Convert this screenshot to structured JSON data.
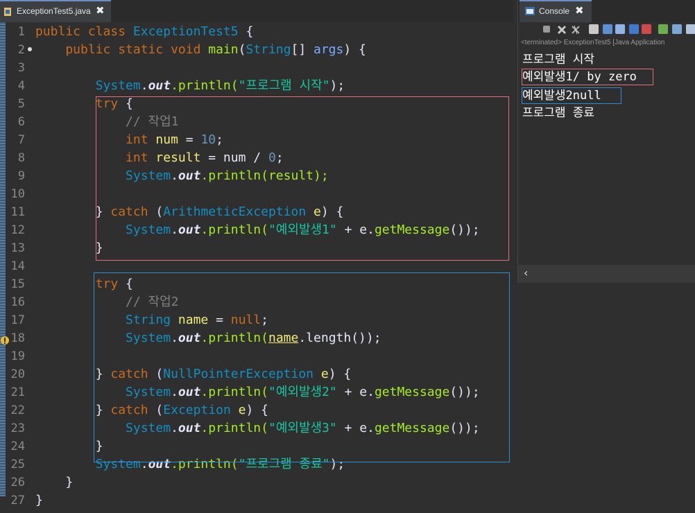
{
  "editor": {
    "tab_title": "ExceptionTest5.java",
    "close_glyph": "✖",
    "line_numbers": [
      "1",
      "2",
      "3",
      "4",
      "5",
      "6",
      "7",
      "8",
      "9",
      "10",
      "11",
      "12",
      "13",
      "14",
      "15",
      "16",
      "17",
      "18",
      "19",
      "20",
      "21",
      "22",
      "23",
      "24",
      "25",
      "26",
      "27"
    ],
    "code": {
      "l1": {
        "a": "public",
        "b": " class ",
        "c": "ExceptionTest5",
        "d": " {"
      },
      "l2": {
        "a": "    public",
        "b": " static",
        "c": " void",
        "d": " main",
        "e": "(",
        "f": "String",
        "g": "[] ",
        "h": "args",
        "i": ") {"
      },
      "l4": {
        "a": "        System",
        "b": ".",
        "c": "out",
        "d": ".println(",
        "e": "\"프로그램 시작\"",
        "f": ");"
      },
      "l5": {
        "a": "        try",
        "b": " {"
      },
      "l6": {
        "a": "            // 작업1"
      },
      "l7": {
        "a": "            int",
        "b": " num",
        "c": " = ",
        "d": "10",
        "e": ";"
      },
      "l8": {
        "a": "            int",
        "b": " result",
        "c": " = num / ",
        "d": "0",
        "e": ";"
      },
      "l9": {
        "a": "            System",
        "b": ".",
        "c": "out",
        "d": ".println(result);"
      },
      "l11": {
        "a": "        }",
        "b": " catch",
        "c": " (",
        "d": "ArithmeticException",
        "e": " e",
        "f": ") {"
      },
      "l12": {
        "a": "            System",
        "b": ".",
        "c": "out",
        "d": ".println(",
        "e": "\"예외발생1\"",
        "f": " + e.",
        "g": "getMessage",
        "h": "());"
      },
      "l13": {
        "a": "        }"
      },
      "l15": {
        "a": "        try",
        "b": " {"
      },
      "l16": {
        "a": "            // 작업2"
      },
      "l17": {
        "a": "            String",
        "b": " name",
        "c": " = ",
        "d": "null",
        "e": ";"
      },
      "l18": {
        "a": "            System",
        "b": ".",
        "c": "out",
        "d": ".println(",
        "e": "name",
        ".": "",
        "f": ".length());"
      },
      "l20": {
        "a": "        }",
        "b": " catch",
        "c": " (",
        "d": "NullPointerException",
        "e": " e",
        "f": ") {"
      },
      "l21": {
        "a": "            System",
        "b": ".",
        "c": "out",
        "d": ".println(",
        "e": "\"예외발생2\"",
        "f": " + e.",
        "g": "getMessage",
        "h": "());"
      },
      "l22": {
        "a": "        }",
        "b": " catch",
        "c": " (",
        "d": "Exception",
        "e": " e",
        "f": ") {"
      },
      "l23": {
        "a": "            System",
        "b": ".",
        "c": "out",
        "d": ".println(",
        "e": "\"예외발생3\"",
        "f": " + e.",
        "g": "getMessage",
        "h": "());"
      },
      "l24": {
        "a": "        }"
      },
      "l25": {
        "a": "        System",
        "b": ".",
        "c": "out",
        "d": ".println(",
        "e": "\"프로그램 종료\"",
        "f": ");"
      },
      "l26": {
        "a": "    }"
      },
      "l27": {
        "a": "}"
      }
    }
  },
  "console": {
    "tab_title": "Console",
    "close_glyph": "✖",
    "status": "<terminated> ExceptionTest5 [Java Application",
    "output": [
      "프로그램 시작",
      "예외발생1/ by zero",
      "예외발생2null",
      "프로그램 종료"
    ],
    "scroll_left_glyph": "‹"
  },
  "icons": [
    "java-file-icon",
    "warning-icon",
    "terminate-icon",
    "remove-launch-icon",
    "remove-all-icon",
    "scroll-lock-icon",
    "pin-console-icon",
    "open-console-icon",
    "display-console-icon"
  ]
}
